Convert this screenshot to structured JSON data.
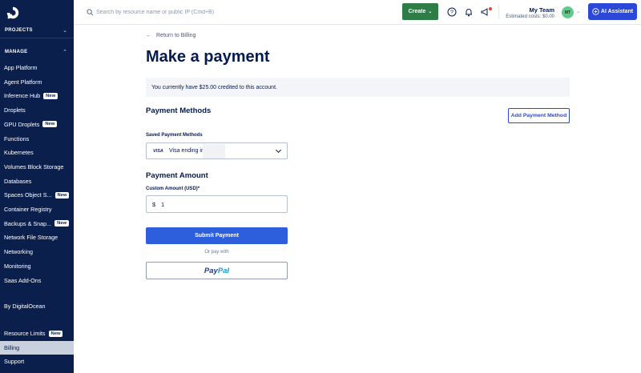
{
  "sidebar": {
    "projects_label": "PROJECTS",
    "manage_label": "MANAGE",
    "items": [
      {
        "label": "App Platform",
        "badge": ""
      },
      {
        "label": "Agent Platform",
        "badge": ""
      },
      {
        "label": "Inference Hub",
        "badge": "New"
      },
      {
        "label": "Droplets",
        "badge": ""
      },
      {
        "label": "GPU Droplets",
        "badge": "New"
      },
      {
        "label": "Functions",
        "badge": ""
      },
      {
        "label": "Kubernetes",
        "badge": ""
      },
      {
        "label": "Volumes Block Storage",
        "badge": ""
      },
      {
        "label": "Databases",
        "badge": ""
      },
      {
        "label": "Spaces Object S...",
        "badge": "New"
      },
      {
        "label": "Container Registry",
        "badge": ""
      },
      {
        "label": "Backups & Snap...",
        "badge": "New"
      },
      {
        "label": "Network File Storage",
        "badge": ""
      },
      {
        "label": "Networking",
        "badge": ""
      },
      {
        "label": "Monitoring",
        "badge": ""
      },
      {
        "label": "Saas Add-Ons",
        "badge": ""
      }
    ],
    "by_do": "By DigitalOcean",
    "bottom_items": [
      {
        "label": "Resource Limits",
        "badge": "New"
      },
      {
        "label": "Billing",
        "badge": ""
      },
      {
        "label": "Support",
        "badge": ""
      }
    ]
  },
  "topbar": {
    "search_placeholder": "Search by resource name or public IP (Cmd+B)",
    "create_label": "Create",
    "team_name": "My Team",
    "estimated_costs": "Estimated costs: $0.00",
    "avatar_initials": "MT",
    "ai_label": "AI Assistant"
  },
  "main": {
    "back_link": "Return to Billing",
    "title": "Make a payment",
    "credit_message": "You currently have $25.00 credited to this account.",
    "payment_methods_title": "Payment Methods",
    "add_method_label": "Add Payment Method",
    "saved_methods_label": "Saved Payment Methods",
    "card_brand": "VISA",
    "card_text": "Visa ending in",
    "payment_amount_title": "Payment Amount",
    "custom_amount_label": "Custom Amount (USD)*",
    "currency_symbol": "$",
    "amount_value": "1",
    "submit_label": "Submit Payment",
    "or_pay_with": "Or pay with",
    "paypal_part1": "Pay",
    "paypal_part2": "Pal"
  },
  "colors": {
    "sidebar_bg": "#0b1f4d",
    "create_green": "#2e7d46",
    "ai_blue": "#2b48d8",
    "submit_blue": "#2d5fdd"
  }
}
